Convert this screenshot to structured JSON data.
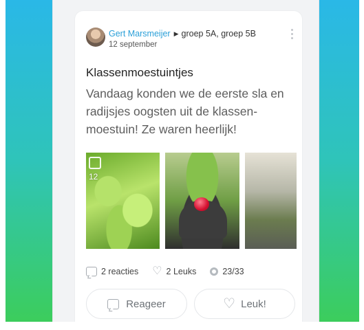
{
  "post": {
    "author": "Gert Marsmeijer",
    "groups": "groep 5A, groep 5B",
    "date": "12 september",
    "title": "Klassenmoestuintjes",
    "body": "Vandaag konden we de eerste sla en radijsjes oogsten uit de klassen-moestuin! Ze waren heerlijk!",
    "photo_count": "12",
    "stats": {
      "reactions": "2 reacties",
      "likes": "2 Leuks",
      "views": "23/33"
    },
    "actions": {
      "react_label": "Reageer",
      "like_label": "Leuk!"
    }
  },
  "colors": {
    "author_link": "#2a9fd8",
    "gradient_top": "#2ab8e7",
    "gradient_bottom": "#3ccd5c"
  },
  "icons": [
    "avatar",
    "caret-right-icon",
    "more-vertical-icon",
    "gallery-icon",
    "comment-icon",
    "heart-icon",
    "eye-icon"
  ]
}
